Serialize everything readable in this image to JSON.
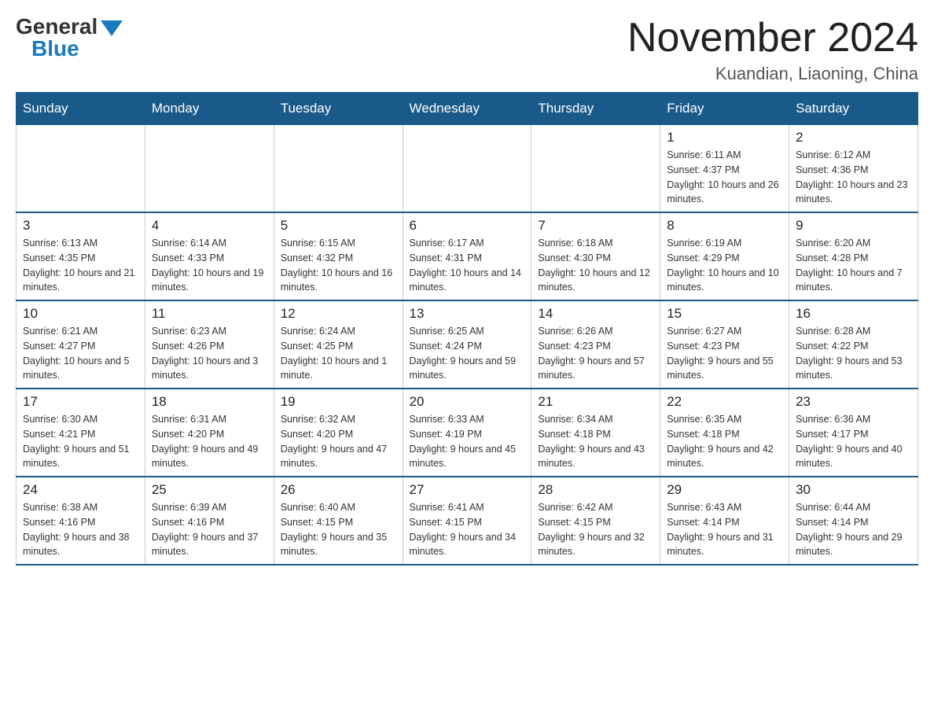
{
  "logo": {
    "general": "General",
    "blue": "Blue",
    "triangle": true
  },
  "title": {
    "month_year": "November 2024",
    "location": "Kuandian, Liaoning, China"
  },
  "days_of_week": [
    "Sunday",
    "Monday",
    "Tuesday",
    "Wednesday",
    "Thursday",
    "Friday",
    "Saturday"
  ],
  "weeks": [
    [
      {
        "day": "",
        "empty": true
      },
      {
        "day": "",
        "empty": true
      },
      {
        "day": "",
        "empty": true
      },
      {
        "day": "",
        "empty": true
      },
      {
        "day": "",
        "empty": true
      },
      {
        "day": "1",
        "sunrise": "6:11 AM",
        "sunset": "4:37 PM",
        "daylight": "10 hours and 26 minutes."
      },
      {
        "day": "2",
        "sunrise": "6:12 AM",
        "sunset": "4:36 PM",
        "daylight": "10 hours and 23 minutes."
      }
    ],
    [
      {
        "day": "3",
        "sunrise": "6:13 AM",
        "sunset": "4:35 PM",
        "daylight": "10 hours and 21 minutes."
      },
      {
        "day": "4",
        "sunrise": "6:14 AM",
        "sunset": "4:33 PM",
        "daylight": "10 hours and 19 minutes."
      },
      {
        "day": "5",
        "sunrise": "6:15 AM",
        "sunset": "4:32 PM",
        "daylight": "10 hours and 16 minutes."
      },
      {
        "day": "6",
        "sunrise": "6:17 AM",
        "sunset": "4:31 PM",
        "daylight": "10 hours and 14 minutes."
      },
      {
        "day": "7",
        "sunrise": "6:18 AM",
        "sunset": "4:30 PM",
        "daylight": "10 hours and 12 minutes."
      },
      {
        "day": "8",
        "sunrise": "6:19 AM",
        "sunset": "4:29 PM",
        "daylight": "10 hours and 10 minutes."
      },
      {
        "day": "9",
        "sunrise": "6:20 AM",
        "sunset": "4:28 PM",
        "daylight": "10 hours and 7 minutes."
      }
    ],
    [
      {
        "day": "10",
        "sunrise": "6:21 AM",
        "sunset": "4:27 PM",
        "daylight": "10 hours and 5 minutes."
      },
      {
        "day": "11",
        "sunrise": "6:23 AM",
        "sunset": "4:26 PM",
        "daylight": "10 hours and 3 minutes."
      },
      {
        "day": "12",
        "sunrise": "6:24 AM",
        "sunset": "4:25 PM",
        "daylight": "10 hours and 1 minute."
      },
      {
        "day": "13",
        "sunrise": "6:25 AM",
        "sunset": "4:24 PM",
        "daylight": "9 hours and 59 minutes."
      },
      {
        "day": "14",
        "sunrise": "6:26 AM",
        "sunset": "4:23 PM",
        "daylight": "9 hours and 57 minutes."
      },
      {
        "day": "15",
        "sunrise": "6:27 AM",
        "sunset": "4:23 PM",
        "daylight": "9 hours and 55 minutes."
      },
      {
        "day": "16",
        "sunrise": "6:28 AM",
        "sunset": "4:22 PM",
        "daylight": "9 hours and 53 minutes."
      }
    ],
    [
      {
        "day": "17",
        "sunrise": "6:30 AM",
        "sunset": "4:21 PM",
        "daylight": "9 hours and 51 minutes."
      },
      {
        "day": "18",
        "sunrise": "6:31 AM",
        "sunset": "4:20 PM",
        "daylight": "9 hours and 49 minutes."
      },
      {
        "day": "19",
        "sunrise": "6:32 AM",
        "sunset": "4:20 PM",
        "daylight": "9 hours and 47 minutes."
      },
      {
        "day": "20",
        "sunrise": "6:33 AM",
        "sunset": "4:19 PM",
        "daylight": "9 hours and 45 minutes."
      },
      {
        "day": "21",
        "sunrise": "6:34 AM",
        "sunset": "4:18 PM",
        "daylight": "9 hours and 43 minutes."
      },
      {
        "day": "22",
        "sunrise": "6:35 AM",
        "sunset": "4:18 PM",
        "daylight": "9 hours and 42 minutes."
      },
      {
        "day": "23",
        "sunrise": "6:36 AM",
        "sunset": "4:17 PM",
        "daylight": "9 hours and 40 minutes."
      }
    ],
    [
      {
        "day": "24",
        "sunrise": "6:38 AM",
        "sunset": "4:16 PM",
        "daylight": "9 hours and 38 minutes."
      },
      {
        "day": "25",
        "sunrise": "6:39 AM",
        "sunset": "4:16 PM",
        "daylight": "9 hours and 37 minutes."
      },
      {
        "day": "26",
        "sunrise": "6:40 AM",
        "sunset": "4:15 PM",
        "daylight": "9 hours and 35 minutes."
      },
      {
        "day": "27",
        "sunrise": "6:41 AM",
        "sunset": "4:15 PM",
        "daylight": "9 hours and 34 minutes."
      },
      {
        "day": "28",
        "sunrise": "6:42 AM",
        "sunset": "4:15 PM",
        "daylight": "9 hours and 32 minutes."
      },
      {
        "day": "29",
        "sunrise": "6:43 AM",
        "sunset": "4:14 PM",
        "daylight": "9 hours and 31 minutes."
      },
      {
        "day": "30",
        "sunrise": "6:44 AM",
        "sunset": "4:14 PM",
        "daylight": "9 hours and 29 minutes."
      }
    ]
  ]
}
